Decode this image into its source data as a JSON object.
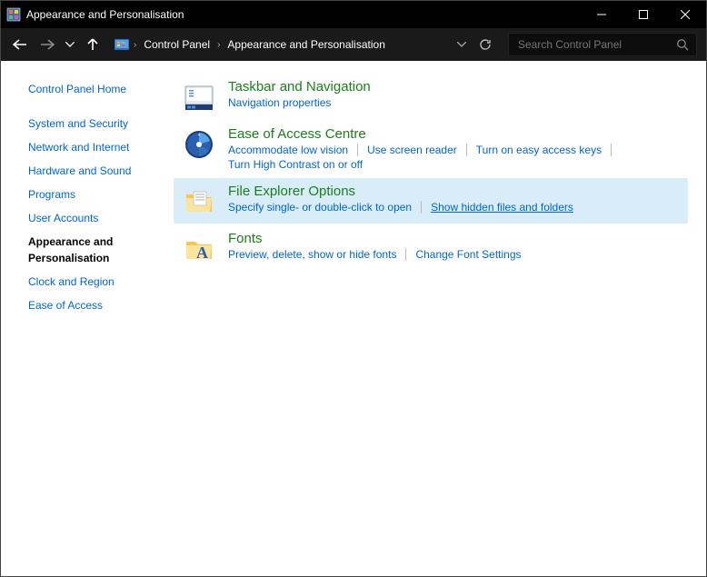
{
  "window": {
    "title": "Appearance and Personalisation"
  },
  "breadcrumb": {
    "root": "Control Panel",
    "current": "Appearance and Personalisation"
  },
  "search": {
    "placeholder": "Search Control Panel"
  },
  "sidebar": {
    "home": "Control Panel Home",
    "items": [
      {
        "label": "System and Security"
      },
      {
        "label": "Network and Internet"
      },
      {
        "label": "Hardware and Sound"
      },
      {
        "label": "Programs"
      },
      {
        "label": "User Accounts"
      },
      {
        "label": "Appearance and Personalisation",
        "current": true
      },
      {
        "label": "Clock and Region"
      },
      {
        "label": "Ease of Access"
      }
    ]
  },
  "categories": [
    {
      "icon": "taskbar-icon",
      "title": "Taskbar and Navigation",
      "links": [
        {
          "label": "Navigation properties"
        }
      ],
      "selected": false
    },
    {
      "icon": "ease-icon",
      "title": "Ease of Access Centre",
      "links": [
        {
          "label": "Accommodate low vision"
        },
        {
          "label": "Use screen reader"
        },
        {
          "label": "Turn on easy access keys"
        },
        {
          "label": "Turn High Contrast on or off"
        }
      ],
      "selected": false
    },
    {
      "icon": "folder-icon",
      "title": "File Explorer Options",
      "links": [
        {
          "label": "Specify single- or double-click to open"
        },
        {
          "label": "Show hidden files and folders",
          "underline": true
        }
      ],
      "selected": true
    },
    {
      "icon": "fonts-icon",
      "title": "Fonts",
      "links": [
        {
          "label": "Preview, delete, show or hide fonts"
        },
        {
          "label": "Change Font Settings"
        }
      ],
      "selected": false
    }
  ]
}
